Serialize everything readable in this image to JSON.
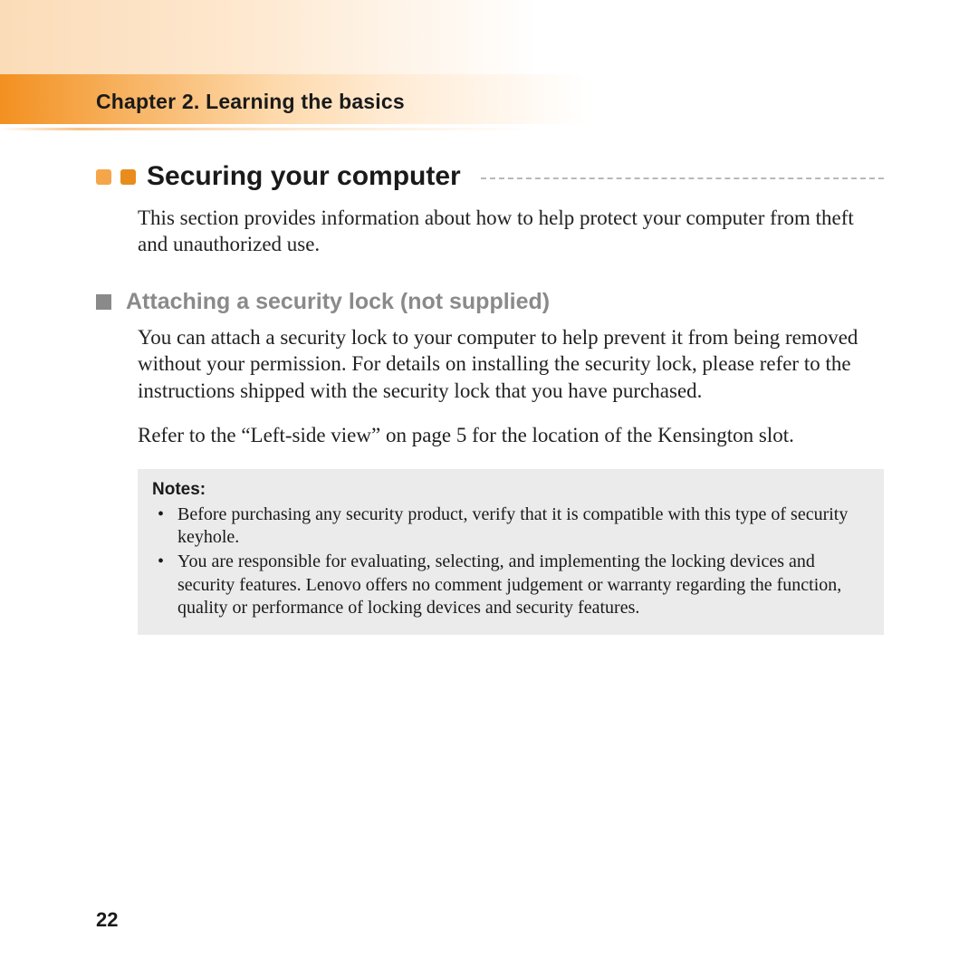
{
  "header": {
    "chapter": "Chapter 2. Learning the basics"
  },
  "section": {
    "title": "Securing your computer",
    "intro": "This section provides information about how to help protect your computer from theft and unauthorized use."
  },
  "subsection": {
    "title": "Attaching a security lock (not supplied)",
    "para1": "You can attach a security lock to your computer to help prevent it from being removed without your permission. For details on installing the security lock, please refer to the instructions shipped with the security lock that you have purchased.",
    "para2": "Refer to the “Left-side view” on page 5 for the location of the Kensington slot."
  },
  "notes": {
    "label": "Notes:",
    "items": [
      "Before purchasing any security product, verify that it is compatible with this type of security keyhole.",
      "You are responsible for evaluating, selecting, and implementing the locking devices and security features. Lenovo offers no comment judgement or warranty regarding the function, quality or performance of locking devices and security features."
    ]
  },
  "page": {
    "number": "22"
  }
}
